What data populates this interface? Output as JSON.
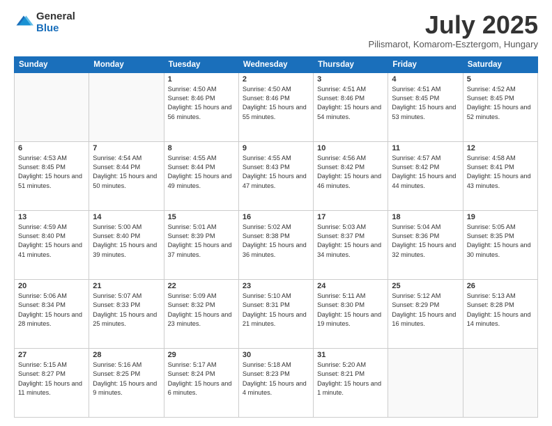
{
  "logo": {
    "general": "General",
    "blue": "Blue"
  },
  "title": "July 2025",
  "subtitle": "Pilismarot, Komarom-Esztergom, Hungary",
  "weekdays": [
    "Sunday",
    "Monday",
    "Tuesday",
    "Wednesday",
    "Thursday",
    "Friday",
    "Saturday"
  ],
  "weeks": [
    [
      {
        "day": "",
        "sunrise": "",
        "sunset": "",
        "daylight": ""
      },
      {
        "day": "",
        "sunrise": "",
        "sunset": "",
        "daylight": ""
      },
      {
        "day": "1",
        "sunrise": "Sunrise: 4:50 AM",
        "sunset": "Sunset: 8:46 PM",
        "daylight": "Daylight: 15 hours and 56 minutes."
      },
      {
        "day": "2",
        "sunrise": "Sunrise: 4:50 AM",
        "sunset": "Sunset: 8:46 PM",
        "daylight": "Daylight: 15 hours and 55 minutes."
      },
      {
        "day": "3",
        "sunrise": "Sunrise: 4:51 AM",
        "sunset": "Sunset: 8:46 PM",
        "daylight": "Daylight: 15 hours and 54 minutes."
      },
      {
        "day": "4",
        "sunrise": "Sunrise: 4:51 AM",
        "sunset": "Sunset: 8:45 PM",
        "daylight": "Daylight: 15 hours and 53 minutes."
      },
      {
        "day": "5",
        "sunrise": "Sunrise: 4:52 AM",
        "sunset": "Sunset: 8:45 PM",
        "daylight": "Daylight: 15 hours and 52 minutes."
      }
    ],
    [
      {
        "day": "6",
        "sunrise": "Sunrise: 4:53 AM",
        "sunset": "Sunset: 8:45 PM",
        "daylight": "Daylight: 15 hours and 51 minutes."
      },
      {
        "day": "7",
        "sunrise": "Sunrise: 4:54 AM",
        "sunset": "Sunset: 8:44 PM",
        "daylight": "Daylight: 15 hours and 50 minutes."
      },
      {
        "day": "8",
        "sunrise": "Sunrise: 4:55 AM",
        "sunset": "Sunset: 8:44 PM",
        "daylight": "Daylight: 15 hours and 49 minutes."
      },
      {
        "day": "9",
        "sunrise": "Sunrise: 4:55 AM",
        "sunset": "Sunset: 8:43 PM",
        "daylight": "Daylight: 15 hours and 47 minutes."
      },
      {
        "day": "10",
        "sunrise": "Sunrise: 4:56 AM",
        "sunset": "Sunset: 8:42 PM",
        "daylight": "Daylight: 15 hours and 46 minutes."
      },
      {
        "day": "11",
        "sunrise": "Sunrise: 4:57 AM",
        "sunset": "Sunset: 8:42 PM",
        "daylight": "Daylight: 15 hours and 44 minutes."
      },
      {
        "day": "12",
        "sunrise": "Sunrise: 4:58 AM",
        "sunset": "Sunset: 8:41 PM",
        "daylight": "Daylight: 15 hours and 43 minutes."
      }
    ],
    [
      {
        "day": "13",
        "sunrise": "Sunrise: 4:59 AM",
        "sunset": "Sunset: 8:40 PM",
        "daylight": "Daylight: 15 hours and 41 minutes."
      },
      {
        "day": "14",
        "sunrise": "Sunrise: 5:00 AM",
        "sunset": "Sunset: 8:40 PM",
        "daylight": "Daylight: 15 hours and 39 minutes."
      },
      {
        "day": "15",
        "sunrise": "Sunrise: 5:01 AM",
        "sunset": "Sunset: 8:39 PM",
        "daylight": "Daylight: 15 hours and 37 minutes."
      },
      {
        "day": "16",
        "sunrise": "Sunrise: 5:02 AM",
        "sunset": "Sunset: 8:38 PM",
        "daylight": "Daylight: 15 hours and 36 minutes."
      },
      {
        "day": "17",
        "sunrise": "Sunrise: 5:03 AM",
        "sunset": "Sunset: 8:37 PM",
        "daylight": "Daylight: 15 hours and 34 minutes."
      },
      {
        "day": "18",
        "sunrise": "Sunrise: 5:04 AM",
        "sunset": "Sunset: 8:36 PM",
        "daylight": "Daylight: 15 hours and 32 minutes."
      },
      {
        "day": "19",
        "sunrise": "Sunrise: 5:05 AM",
        "sunset": "Sunset: 8:35 PM",
        "daylight": "Daylight: 15 hours and 30 minutes."
      }
    ],
    [
      {
        "day": "20",
        "sunrise": "Sunrise: 5:06 AM",
        "sunset": "Sunset: 8:34 PM",
        "daylight": "Daylight: 15 hours and 28 minutes."
      },
      {
        "day": "21",
        "sunrise": "Sunrise: 5:07 AM",
        "sunset": "Sunset: 8:33 PM",
        "daylight": "Daylight: 15 hours and 25 minutes."
      },
      {
        "day": "22",
        "sunrise": "Sunrise: 5:09 AM",
        "sunset": "Sunset: 8:32 PM",
        "daylight": "Daylight: 15 hours and 23 minutes."
      },
      {
        "day": "23",
        "sunrise": "Sunrise: 5:10 AM",
        "sunset": "Sunset: 8:31 PM",
        "daylight": "Daylight: 15 hours and 21 minutes."
      },
      {
        "day": "24",
        "sunrise": "Sunrise: 5:11 AM",
        "sunset": "Sunset: 8:30 PM",
        "daylight": "Daylight: 15 hours and 19 minutes."
      },
      {
        "day": "25",
        "sunrise": "Sunrise: 5:12 AM",
        "sunset": "Sunset: 8:29 PM",
        "daylight": "Daylight: 15 hours and 16 minutes."
      },
      {
        "day": "26",
        "sunrise": "Sunrise: 5:13 AM",
        "sunset": "Sunset: 8:28 PM",
        "daylight": "Daylight: 15 hours and 14 minutes."
      }
    ],
    [
      {
        "day": "27",
        "sunrise": "Sunrise: 5:15 AM",
        "sunset": "Sunset: 8:27 PM",
        "daylight": "Daylight: 15 hours and 11 minutes."
      },
      {
        "day": "28",
        "sunrise": "Sunrise: 5:16 AM",
        "sunset": "Sunset: 8:25 PM",
        "daylight": "Daylight: 15 hours and 9 minutes."
      },
      {
        "day": "29",
        "sunrise": "Sunrise: 5:17 AM",
        "sunset": "Sunset: 8:24 PM",
        "daylight": "Daylight: 15 hours and 6 minutes."
      },
      {
        "day": "30",
        "sunrise": "Sunrise: 5:18 AM",
        "sunset": "Sunset: 8:23 PM",
        "daylight": "Daylight: 15 hours and 4 minutes."
      },
      {
        "day": "31",
        "sunrise": "Sunrise: 5:20 AM",
        "sunset": "Sunset: 8:21 PM",
        "daylight": "Daylight: 15 hours and 1 minute."
      },
      {
        "day": "",
        "sunrise": "",
        "sunset": "",
        "daylight": ""
      },
      {
        "day": "",
        "sunrise": "",
        "sunset": "",
        "daylight": ""
      }
    ]
  ]
}
